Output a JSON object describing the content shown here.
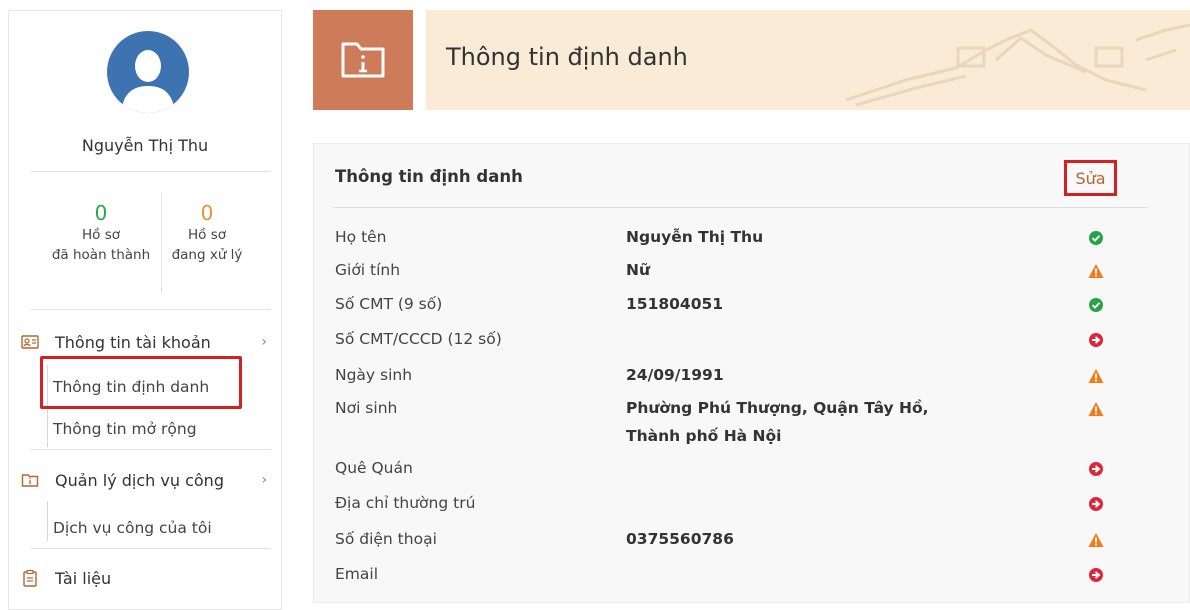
{
  "user": {
    "name": "Nguyễn Thị Thu"
  },
  "stats": [
    {
      "count": "0",
      "label_line1": "Hồ sơ",
      "label_line2": "đã hoàn thành",
      "color": "#2aa84a"
    },
    {
      "count": "0",
      "label_line1": "Hồ sơ",
      "label_line2": "đang xử lý",
      "color": "#e8932b"
    }
  ],
  "menu": {
    "account": {
      "label": "Thông tin tài khoản",
      "icon": "id-card-icon"
    },
    "account_sub": [
      "Thông tin định danh",
      "Thông tin mở rộng"
    ],
    "public_services": {
      "label": "Quản lý dịch vụ công",
      "icon": "folder-icon"
    },
    "public_services_sub": [
      "Dịch vụ công của tôi"
    ],
    "documents": {
      "label": "Tài liệu",
      "icon": "clipboard-icon"
    }
  },
  "header": {
    "title": "Thông tin định danh",
    "icon": "folder-info-icon"
  },
  "panel": {
    "title": "Thông tin định danh",
    "edit_label": "Sửa",
    "rows": [
      {
        "label": "Họ tên",
        "value": "Nguyễn Thị Thu",
        "status": "check"
      },
      {
        "label": "Giới tính",
        "value": "Nữ",
        "status": "warning"
      },
      {
        "label": "Số CMT (9 số)",
        "value": "151804051",
        "status": "check"
      },
      {
        "label": "Số CMT/CCCD (12 số)",
        "value": "",
        "status": "arrow"
      },
      {
        "label": "Ngày sinh",
        "value": "24/09/1991",
        "status": "warning"
      },
      {
        "label": "Nơi sinh",
        "value_line1": "Phường Phú Thượng, Quận Tây Hồ,",
        "value_line2": "Thành phố Hà Nội",
        "status": "warning"
      },
      {
        "label": "Quê Quán",
        "value": "",
        "status": "arrow"
      },
      {
        "label": "Địa chỉ thường trú",
        "value": "",
        "status": "arrow"
      },
      {
        "label": "Số điện thoại",
        "value": "0375560786",
        "status": "warning"
      },
      {
        "label": "Email",
        "value": "",
        "status": "arrow"
      }
    ]
  },
  "colors": {
    "check": "#27a347",
    "warning": "#f07c1b",
    "arrow": "#e0243a",
    "accent": "#cd7b59",
    "highlight": "#d42020"
  }
}
